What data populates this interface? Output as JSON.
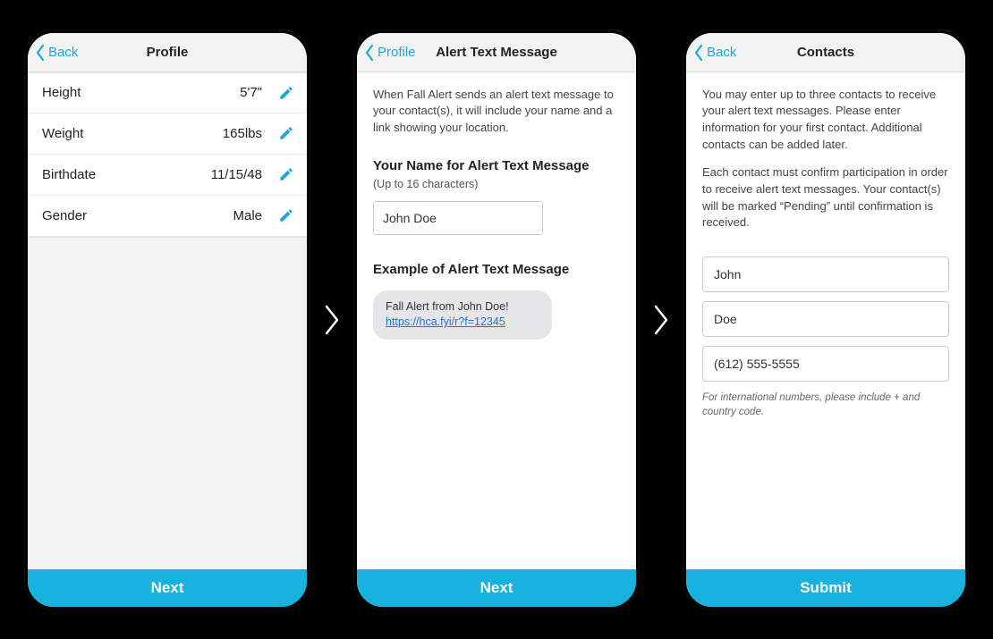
{
  "screen1": {
    "back": "Back",
    "title": "Profile",
    "rows": [
      {
        "label": "Height",
        "value": "5'7\""
      },
      {
        "label": "Weight",
        "value": "165lbs"
      },
      {
        "label": "Birthdate",
        "value": "11/15/48"
      },
      {
        "label": "Gender",
        "value": "Male"
      }
    ],
    "next": "Next"
  },
  "screen2": {
    "back": "Profile",
    "title": "Alert Text Message",
    "intro": "When Fall Alert sends an alert text message to your contact(s), it will include your name and a link showing your location.",
    "name_label": "Your Name for Alert Text Message",
    "name_sub": "(Up to 16 characters)",
    "name_value": "John Doe",
    "example_label": "Example of Alert Text Message",
    "bubble_line1": "Fall Alert from John Doe!",
    "bubble_link": "https://hca.fyi/r?f=12345",
    "next": "Next"
  },
  "screen3": {
    "back": "Back",
    "title": "Contacts",
    "para1": "You may enter up to three contacts to receive your alert text messages. Please enter information for your first contact. Additional contacts can be added later.",
    "para2": "Each contact must confirm participation in order to receive alert text messages. Your contact(s) will be marked “Pending” until confirmation is received.",
    "first": "John",
    "last": "Doe",
    "phone": "(612) 555-5555",
    "hint": "For international numbers, please include + and country code.",
    "submit": "Submit"
  }
}
